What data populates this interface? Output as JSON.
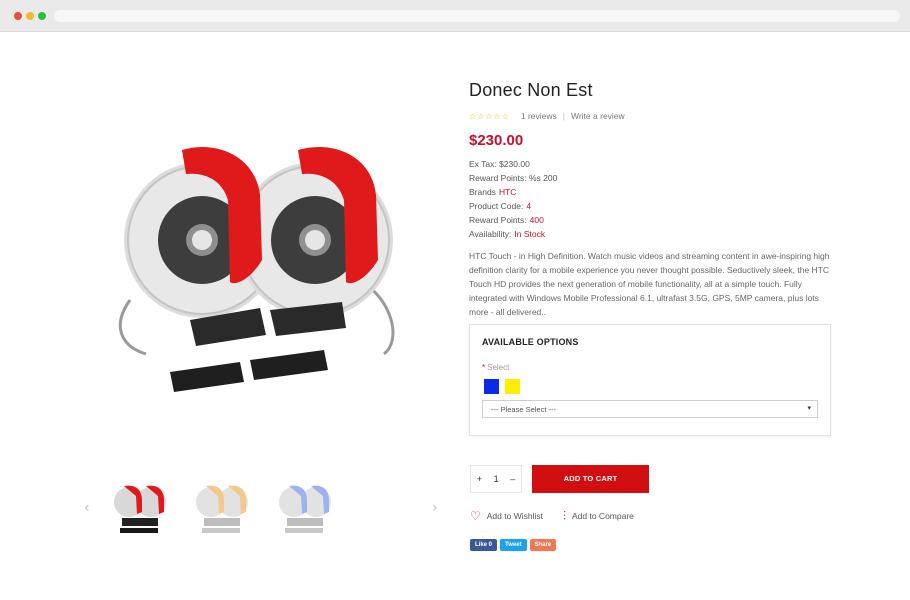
{
  "product": {
    "title": "Donec Non Est",
    "reviews": "1 reviews",
    "write_review": "Write a review",
    "price": "$230.00",
    "meta": [
      {
        "label": "Ex Tax: $230.00",
        "value": ""
      },
      {
        "label": "Reward Points: %s 200",
        "value": ""
      },
      {
        "label": "Brands",
        "value": "HTC"
      },
      {
        "label": "Product Code:",
        "value": "4"
      },
      {
        "label": "Reward Points:",
        "value": "400"
      },
      {
        "label": "Availability:",
        "value": "In Stock"
      }
    ],
    "rating": 0,
    "stars_max": 5,
    "description": "HTC Touch - in High Definition. Watch music videos and streaming content in awe-inspiring high definition clarity for a mobile experience you never thought possible. Seductively sleek, the HTC Touch HD provides the next generation of mobile functionality, all at a simple touch. Fully integrated with Windows Mobile Professional 6.1, ultrafast 3.5G, GPS, 5MP camera, plus lots more - all delivered.."
  },
  "options": {
    "title": "AVAILABLE OPTIONS",
    "required_mark": "*",
    "select_label": "Select",
    "swatches": [
      {
        "name": "blue",
        "color": "#0a2ae6"
      },
      {
        "name": "yellow",
        "color": "#ffee00"
      }
    ],
    "dropdown_value": "--- Please Select ---"
  },
  "purchase": {
    "qty_plus": "+",
    "qty_value": "1",
    "qty_minus": "–",
    "add_to_cart": "ADD TO CART"
  },
  "actions": {
    "wishlist": "Add to Wishlist",
    "compare": "Add to Compare"
  },
  "share": {
    "like": "Like 0",
    "tweet": "Tweet",
    "share": "Share"
  },
  "colors": {
    "accent": "#d20f10",
    "price": "#c8102e",
    "star": "#f2b01e"
  },
  "thumbnails": [
    {
      "variant": "red"
    },
    {
      "variant": "gold"
    },
    {
      "variant": "blue"
    }
  ]
}
